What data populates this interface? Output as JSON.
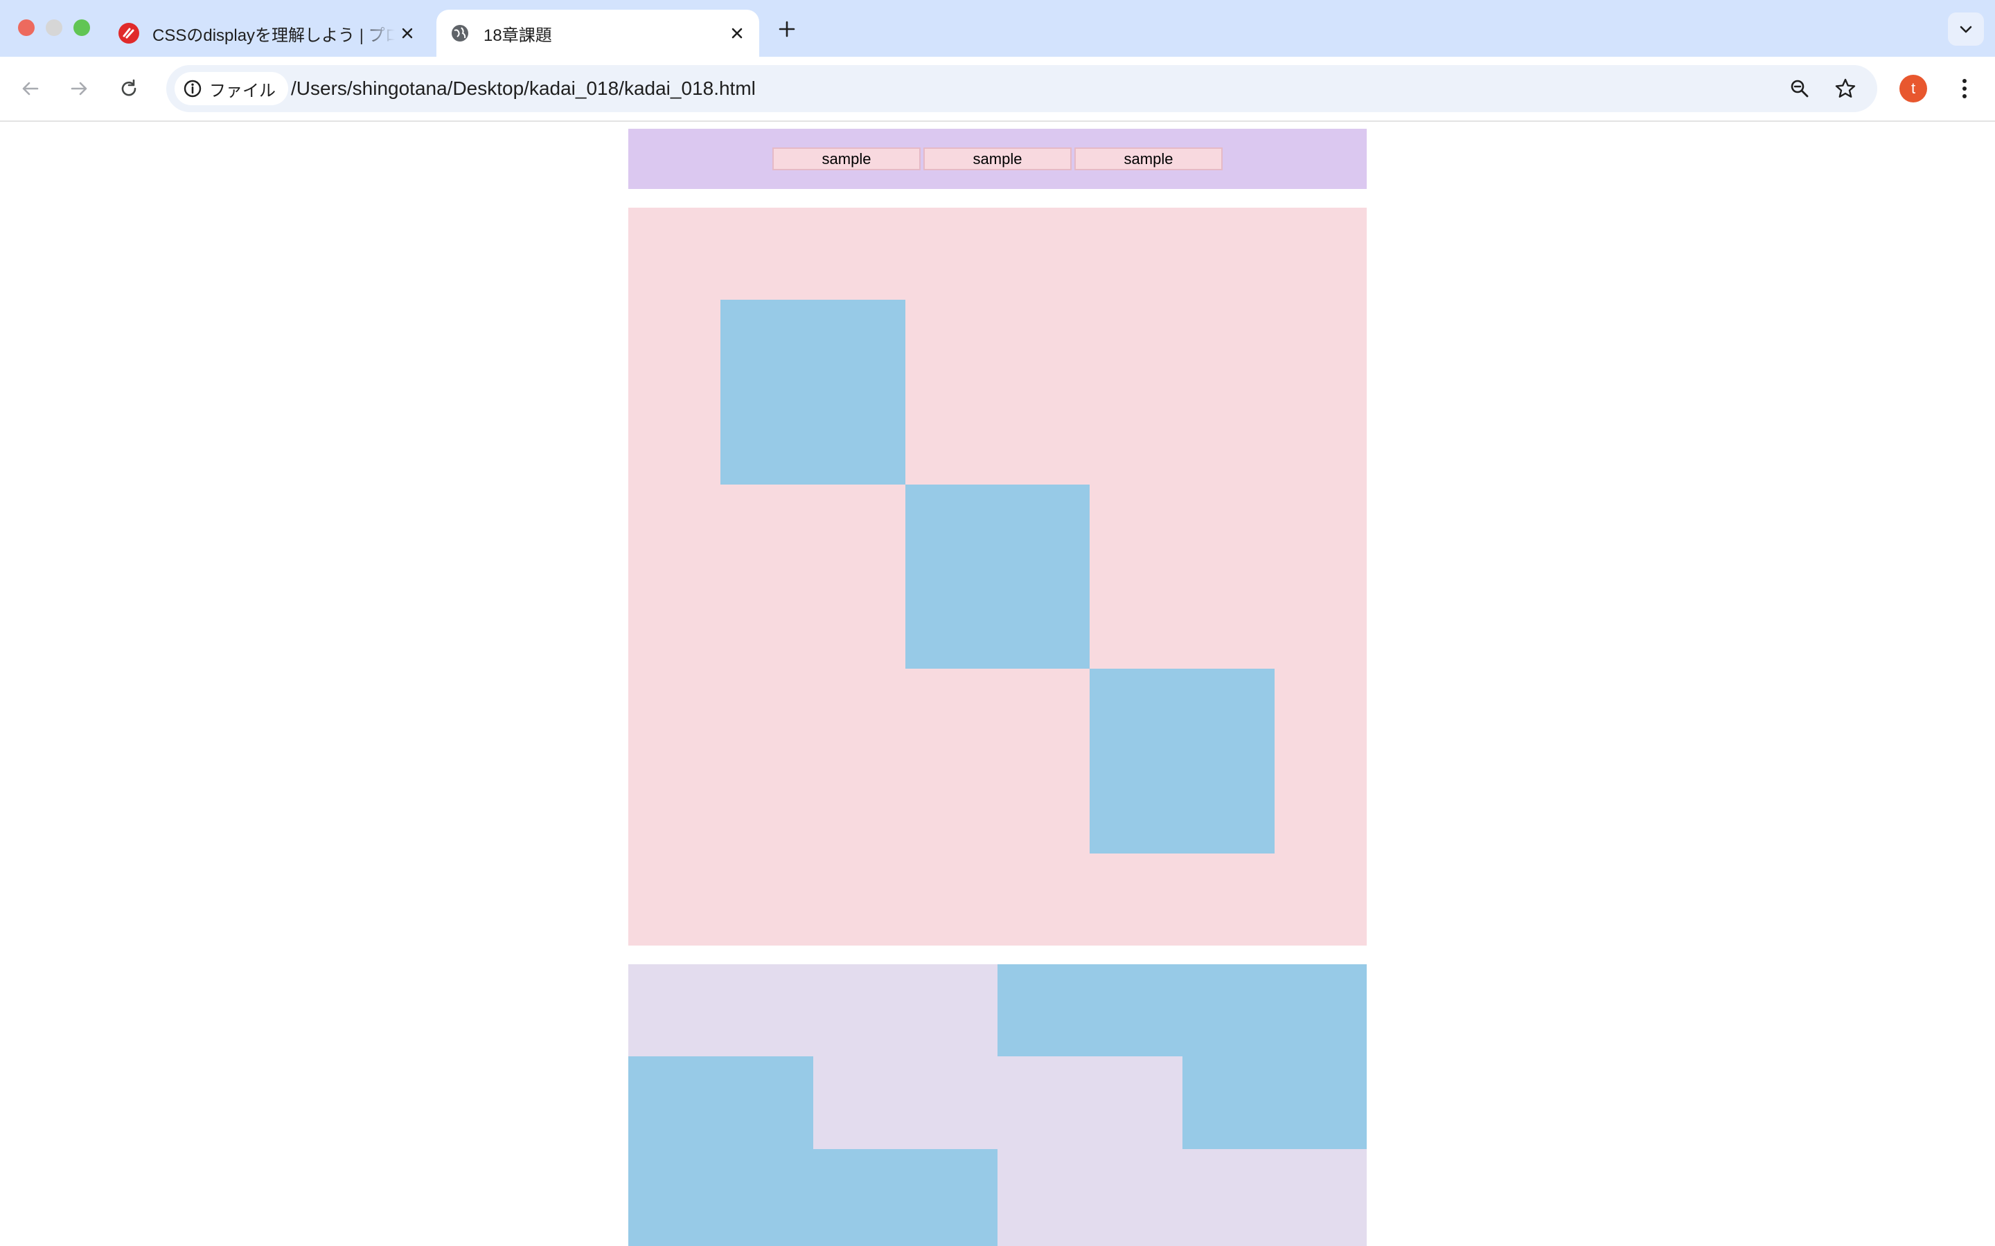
{
  "browser": {
    "tabs": [
      {
        "title": "CSSのdisplayを理解しよう | プロ",
        "icon": "samurai-logo-icon",
        "active": false
      },
      {
        "title": "18章課題",
        "icon": "globe-icon",
        "active": true
      }
    ],
    "address_bar": {
      "security_chip_label": "ファイル",
      "url": "/Users/shingotana/Desktop/kadai_018/kadai_018.html"
    },
    "profile_initial": "t"
  },
  "page": {
    "nav_items": [
      "sample",
      "sample",
      "sample"
    ],
    "colors": {
      "navbar_bg": "#dbc8f0",
      "nav_item_bg": "#f8d9df",
      "section1_bg": "#f8dadf",
      "section2_bg": "#e3dcee",
      "box_blue": "#97cae7"
    }
  }
}
